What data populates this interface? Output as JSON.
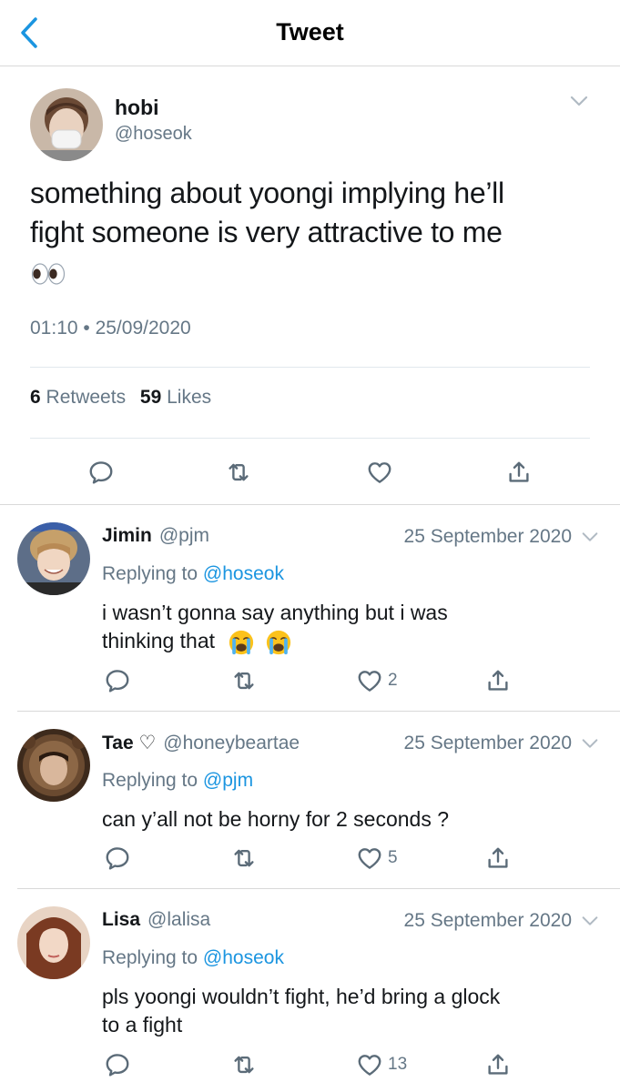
{
  "header": {
    "title": "Tweet"
  },
  "tweet": {
    "name": "hobi",
    "handle": "@hoseok",
    "text_line1": "something about yoongi implying he’ll",
    "text_line2": "fight someone is very attractive to me",
    "timestamp": "01:10 • 25/09/2020",
    "retweets": "6",
    "retweets_label": "Retweets",
    "likes": "59",
    "likes_label": "Likes"
  },
  "replies": [
    {
      "name": "Jimin",
      "handle": "@pjm",
      "date": "25 September 2020",
      "replying_prefix": "Replying to",
      "replying_to": "@hoseok",
      "text_line1": "i wasn’t gonna say anything but i was",
      "text_line2": "thinking that",
      "likes": "2"
    },
    {
      "name": "Tae ♡",
      "handle": "@honeybeartae",
      "date": "25 September 2020",
      "replying_prefix": "Replying to",
      "replying_to": "@pjm",
      "text_line1": "can y’all not be horny for 2 seconds ?",
      "likes": "5"
    },
    {
      "name": "Lisa",
      "handle": "@lalisa",
      "date": "25 September 2020",
      "replying_prefix": "Replying to",
      "replying_to": "@hoseok",
      "text_line1": "pls yoongi wouldn’t fight, he’d bring a glock",
      "text_line2": "to a fight",
      "likes": "13"
    }
  ],
  "colors": {
    "accent": "#1b95e0",
    "secondary_text": "#657786",
    "icon": "#5b6b78"
  },
  "icons": [
    "chevron-left-icon",
    "chevron-down-icon",
    "reply-icon",
    "retweet-icon",
    "heart-icon",
    "share-icon",
    "eyes-emoji",
    "crying-emoji"
  ]
}
